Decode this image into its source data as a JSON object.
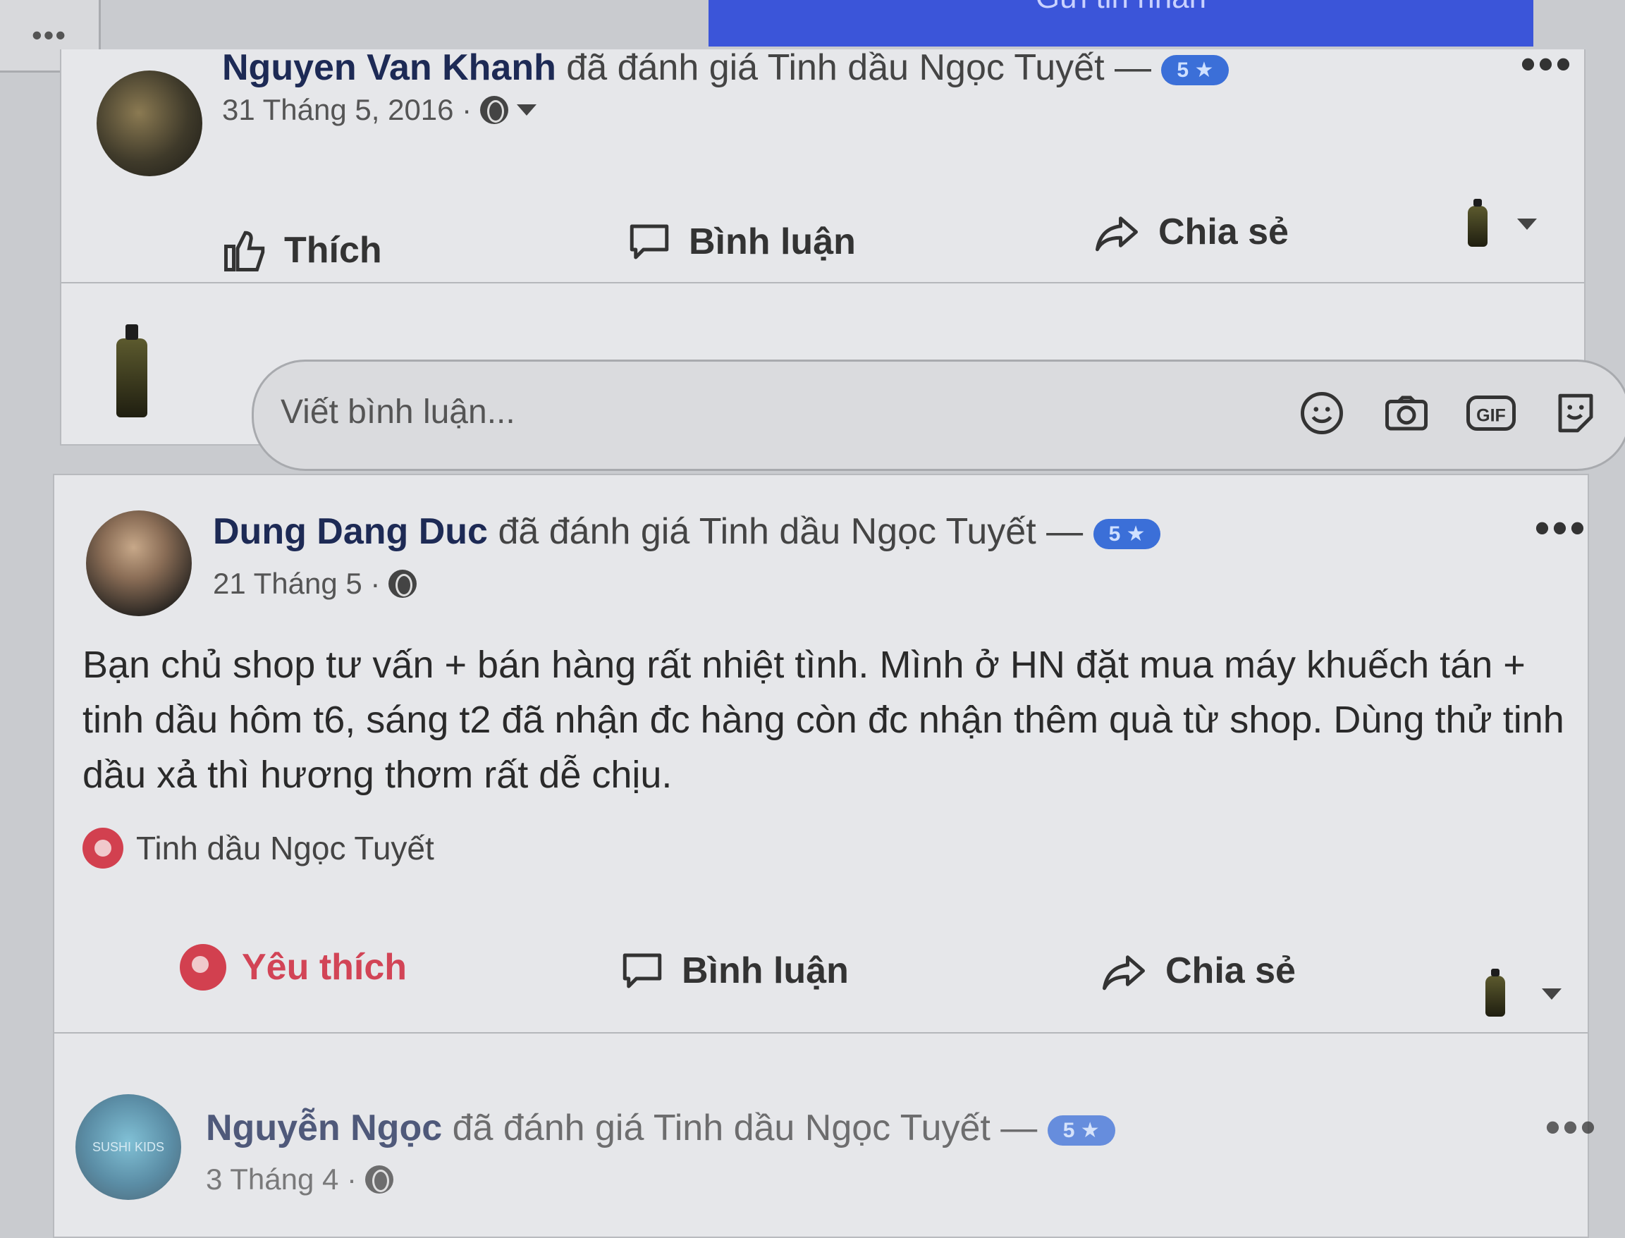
{
  "top": {
    "menu_dots": "•••",
    "blue_text": "Gửi tin nhắn"
  },
  "posts": [
    {
      "author": "Nguyen Van Khanh",
      "action": "đã đánh giá Tinh dầu Ngọc Tuyết —",
      "rating": "5 ★",
      "date": "31 Tháng 5, 2016 ·",
      "actions": {
        "like": "Thích",
        "comment": "Bình luận",
        "share": "Chia sẻ"
      },
      "comment_placeholder": "Viết bình luận...",
      "menu_dots": "•••"
    },
    {
      "author": "Dung Dang Duc",
      "action": "đã đánh giá Tinh dầu Ngọc Tuyết —",
      "rating": "5 ★",
      "date": "21 Tháng 5 ·",
      "body": "Bạn chủ shop tư vấn + bán hàng rất nhiệt tình. Mình ở HN đặt mua máy khuếch tán + tinh dầu hôm t6, sáng t2 đã nhận đc hàng còn đc nhận thêm quà từ shop. Dùng thử tinh dầu xả thì hương thơm rất dễ chịu.",
      "tag": "Tinh dầu Ngọc Tuyết",
      "actions": {
        "like": "Yêu thích",
        "comment": "Bình luận",
        "share": "Chia sẻ"
      },
      "menu_dots": "•••"
    },
    {
      "author": "Nguyễn Ngọc",
      "action": "đã đánh giá Tinh dầu Ngọc Tuyết —",
      "rating": "5 ★",
      "date": "3 Tháng 4 ·",
      "avatar_text": "SUSHI KIDS",
      "menu_dots": "•••"
    }
  ],
  "colors": {
    "accent_blue": "#3b6fd8",
    "love_red": "#d24456",
    "card_bg": "#e6e7ea"
  }
}
